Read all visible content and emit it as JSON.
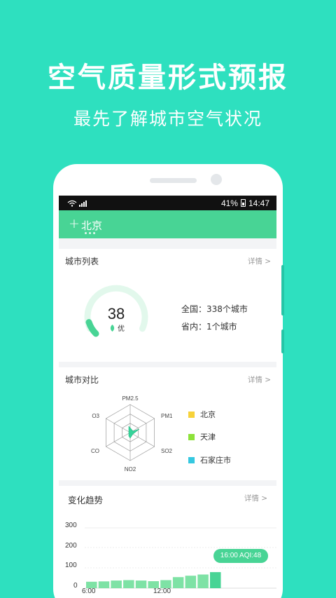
{
  "promo": {
    "title": "空气质量形式预报",
    "subtitle": "最先了解城市空气状况"
  },
  "statusbar": {
    "battery": "41%",
    "time": "14:47"
  },
  "appbar": {
    "add_symbol": "+",
    "city": "北京"
  },
  "city_list": {
    "title": "城市列表",
    "detail": "详情 >",
    "aqi": "38",
    "level": "优",
    "national": "全国：338个城市",
    "province": "省内：1个城市",
    "gauge_fraction": 0.1
  },
  "compare": {
    "title": "城市对比",
    "detail": "详情 >",
    "axes": [
      "PM2.5",
      "PM10",
      "SO2",
      "NO2",
      "CO",
      "O3"
    ],
    "legend": [
      {
        "name": "北京",
        "color": "#f7d23a"
      },
      {
        "name": "天津",
        "color": "#8de23a"
      },
      {
        "name": "石家庄市",
        "color": "#35c8e0"
      }
    ]
  },
  "trend": {
    "title": "变化趋势",
    "detail": "详情 >",
    "tooltip": "16:00 AQI:48",
    "x_labels": [
      "6:00",
      "12:00"
    ],
    "chart_data": {
      "type": "bar",
      "ylim": [
        0,
        300
      ],
      "yticks": [
        "300",
        "200",
        "100",
        "0"
      ],
      "values": [
        32,
        34,
        38,
        40,
        38,
        35,
        40,
        55,
        62,
        68,
        80
      ],
      "color": "#7ee2a5",
      "highlight_color": "#48d495"
    }
  }
}
